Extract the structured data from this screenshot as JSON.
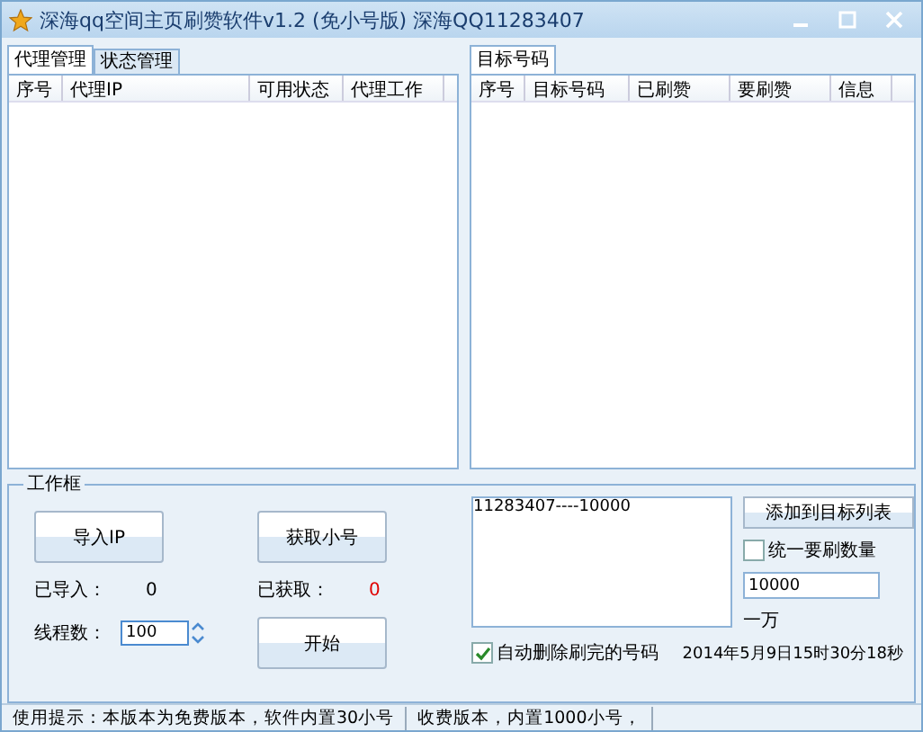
{
  "window": {
    "title": "深海qq空间主页刷赞软件v1.2  (免小号版)  深海QQ11283407"
  },
  "left_tabs": [
    {
      "label": "代理管理",
      "selected": true
    },
    {
      "label": "状态管理",
      "selected": false
    }
  ],
  "proxy_table": {
    "columns": [
      "序号",
      "代理IP",
      "可用状态",
      "代理工作"
    ]
  },
  "right_tabs": [
    {
      "label": "目标号码",
      "selected": true
    }
  ],
  "target_table": {
    "columns": [
      "序号",
      "目标号码",
      "已刷赞",
      "要刷赞",
      "信息"
    ]
  },
  "work_group": {
    "title": "工作框",
    "import_button": "导入IP",
    "fetch_button": "获取小号",
    "imported_label": "已导入：",
    "imported_value": "0",
    "fetched_label": "已获取：",
    "fetched_value": "0",
    "threads_label": "线程数：",
    "threads_value": "100",
    "start_button": "开始"
  },
  "targets_box": {
    "value": "11283407----10000"
  },
  "add_button": "添加到目标列表",
  "uniform_count": {
    "label": "统一要刷数量",
    "checked": false,
    "value": "10000",
    "hint": "一万"
  },
  "auto_delete": {
    "label": "自动删除刷完的号码",
    "checked": true
  },
  "datetime": "2014年5月9日15时30分18秒",
  "status_bar": [
    "使用提示：本版本为免费版本，软件内置30小号",
    "收费版本，内置1000小号，"
  ]
}
